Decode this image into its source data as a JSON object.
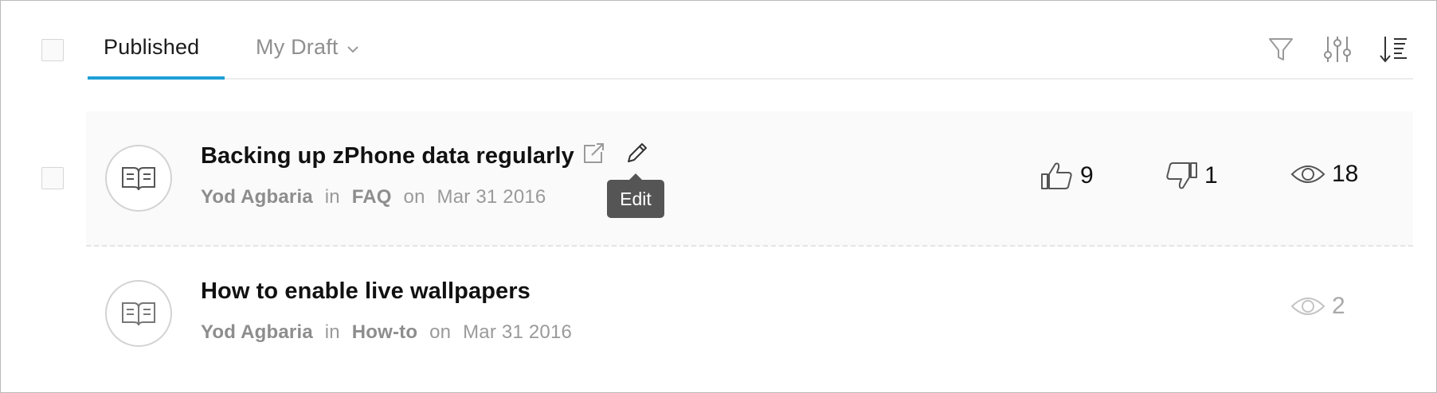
{
  "tabs": [
    {
      "label": "Published",
      "active": true
    },
    {
      "label": "My Draft",
      "active": false
    }
  ],
  "toolbar": {
    "filter_icon": "filter-icon",
    "settings_icon": "sliders-icon",
    "sort_icon": "sort-icon"
  },
  "articles": [
    {
      "title": "Backing up zPhone data regularly",
      "author": "Yod Agbaria",
      "in_word": "in",
      "category": "FAQ",
      "on_word": "on",
      "date": "Mar 31 2016",
      "likes": "9",
      "dislikes": "1",
      "views": "18"
    },
    {
      "title": "How to enable live wallpapers",
      "author": "Yod Agbaria",
      "in_word": "in",
      "category": "How-to",
      "on_word": "on",
      "date": "Mar 31 2016",
      "views": "2"
    }
  ],
  "tooltip": {
    "label": "Edit"
  },
  "colors": {
    "accent": "#1f9fd8",
    "muted_text": "#9a9a9a",
    "tooltip_bg": "#555555"
  }
}
